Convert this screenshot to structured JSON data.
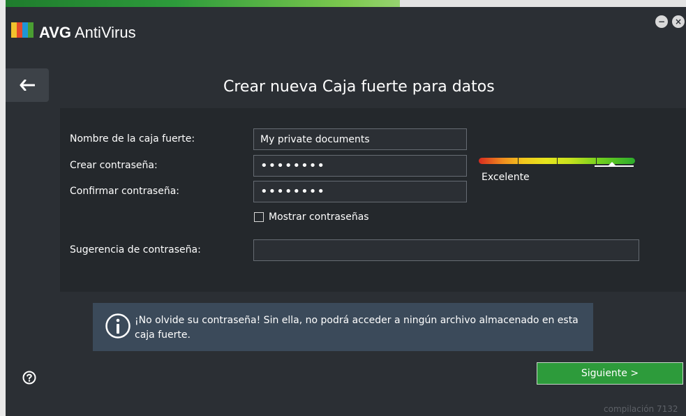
{
  "app": {
    "title_bold": "AVG",
    "title_rest": "AntiVirus"
  },
  "window_controls": {
    "minimize_icon": "minimize-icon",
    "close_icon": "close-icon"
  },
  "header": {
    "back_icon": "arrow-left-icon",
    "title": "Crear nueva Caja fuerte para datos"
  },
  "form": {
    "vault_name_label": "Nombre de la caja fuerte:",
    "vault_name_value": "My private documents",
    "create_password_label": "Crear contraseña:",
    "create_password_value": "••••••••",
    "confirm_password_label": "Confirmar contraseña:",
    "confirm_password_value": "••••••••",
    "show_passwords_label": "Mostrar contraseñas",
    "show_passwords_checked": false,
    "password_hint_label": "Sugerencia de contraseña:",
    "password_hint_value": ""
  },
  "strength": {
    "label": "Excelente",
    "level": 0.83,
    "colors": [
      "#d82b1f",
      "#ef8a1f",
      "#f2c51d",
      "#e6e51d",
      "#c8e21e",
      "#6fcf1f",
      "#2cab2c"
    ]
  },
  "info": {
    "icon": "info-icon",
    "text": "¡No olvide su contraseña! Sin ella, no podrá acceder a ningún archivo almacenado en esta caja fuerte."
  },
  "footer": {
    "help_icon": "help-icon",
    "next_label": "Siguiente >",
    "build_text": "compilación 7132"
  },
  "colors": {
    "background": "#2b2f34",
    "panel": "#24282c",
    "info_panel": "#3b4a5a",
    "accent": "#2d9b3b"
  }
}
